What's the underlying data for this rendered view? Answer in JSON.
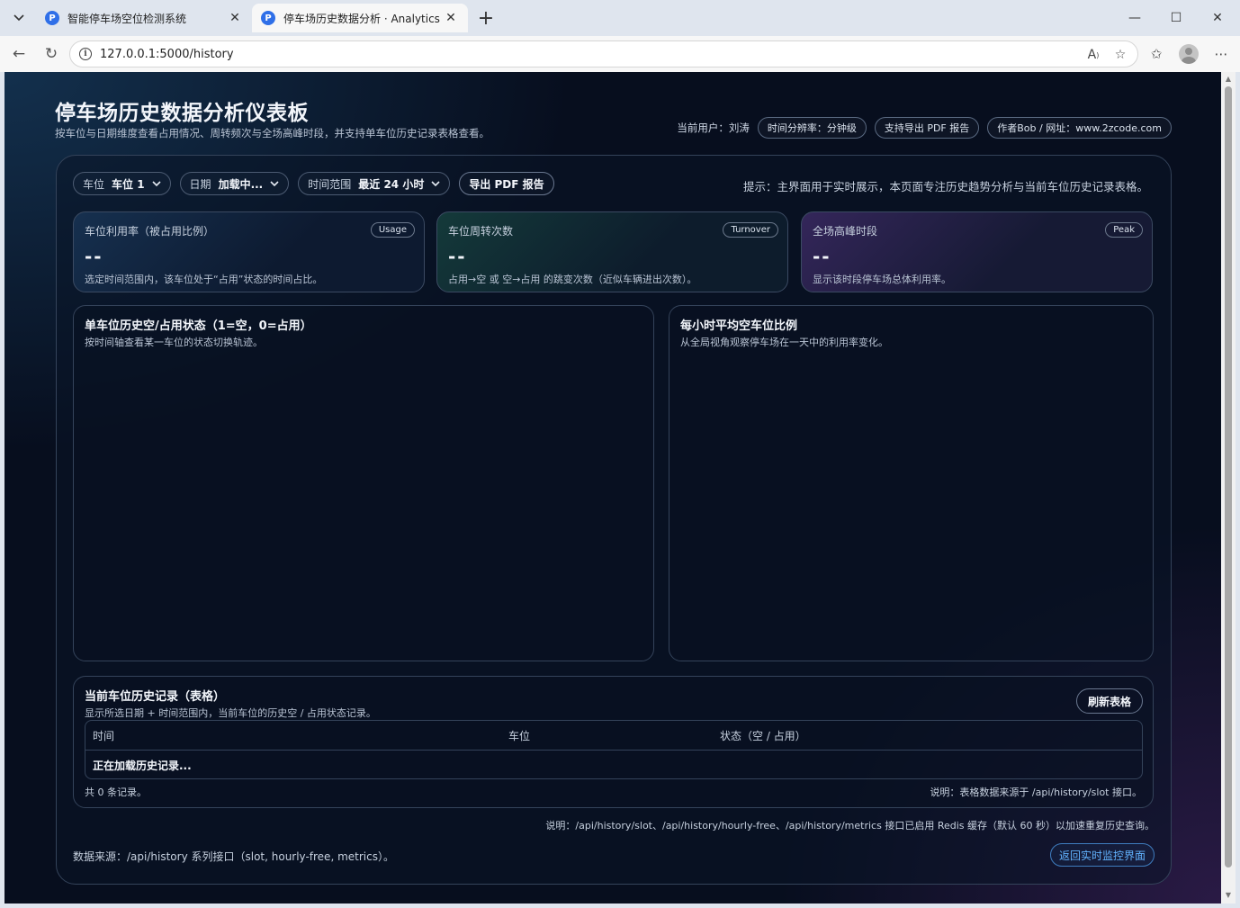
{
  "browser": {
    "tabs": [
      {
        "title": "智能停车场空位检测系统",
        "favicon": "P",
        "active": false
      },
      {
        "title": "停车场历史数据分析 · Analytics",
        "favicon": "P",
        "active": true
      }
    ],
    "url": "127.0.0.1:5000/history"
  },
  "header": {
    "title": "停车场历史数据分析仪表板",
    "subtitle": "按车位与日期维度查看占用情况、周转频次与全场高峰时段，并支持单车位历史记录表格查看。",
    "current_user": "当前用户：刘涛",
    "chips": [
      "时间分辨率：分钟级",
      "支持导出 PDF 报告",
      "作者Bob / 网址：www.2zcode.com"
    ]
  },
  "filters": {
    "slot_label": "车位",
    "slot_value": "车位 1",
    "date_label": "日期",
    "date_value": "加载中...",
    "range_label": "时间范围",
    "range_value": "最近 24 小时",
    "export_btn": "导出 PDF 报告",
    "hint": "提示：主界面用于实时展示，本页面专注历史趋势分析与当前车位历史记录表格。"
  },
  "stats": [
    {
      "label": "车位利用率（被占用比例）",
      "badge": "Usage",
      "value": "--",
      "desc": "选定时间范围内，该车位处于“占用”状态的时间占比。"
    },
    {
      "label": "车位周转次数",
      "badge": "Turnover",
      "value": "--",
      "desc": "占用→空 或 空→占用 的跳变次数（近似车辆进出次数）。"
    },
    {
      "label": "全场高峰时段",
      "badge": "Peak",
      "value": "--",
      "desc": "显示该时段停车场总体利用率。"
    }
  ],
  "charts": {
    "slot_history": {
      "title": "单车位历史空/占用状态（1=空，0=占用）",
      "subtitle": "按时间轴查看某一车位的状态切换轨迹。"
    },
    "hourly_free": {
      "title": "每小时平均空车位比例",
      "subtitle": "从全局视角观察停车场在一天中的利用率变化。"
    }
  },
  "history_table": {
    "title": "当前车位历史记录（表格）",
    "subtitle": "显示所选日期 + 时间范围内，当前车位的历史空 / 占用状态记录。",
    "refresh_btn": "刷新表格",
    "columns": [
      "时间",
      "车位",
      "状态（空 / 占用）"
    ],
    "loading_row": "正在加载历史记录...",
    "count_text": "共 0 条记录。",
    "source_text": "说明：表格数据来源于 /api/history/slot 接口。"
  },
  "footer": {
    "cache_note": "说明：/api/history/slot、/api/history/hourly-free、/api/history/metrics 接口已启用 Redis 缓存（默认 60 秒）以加速重复历史查询。",
    "source_note": "数据来源：/api/history 系列接口（slot, hourly-free, metrics）。",
    "back_btn": "返回实时监控界面"
  }
}
